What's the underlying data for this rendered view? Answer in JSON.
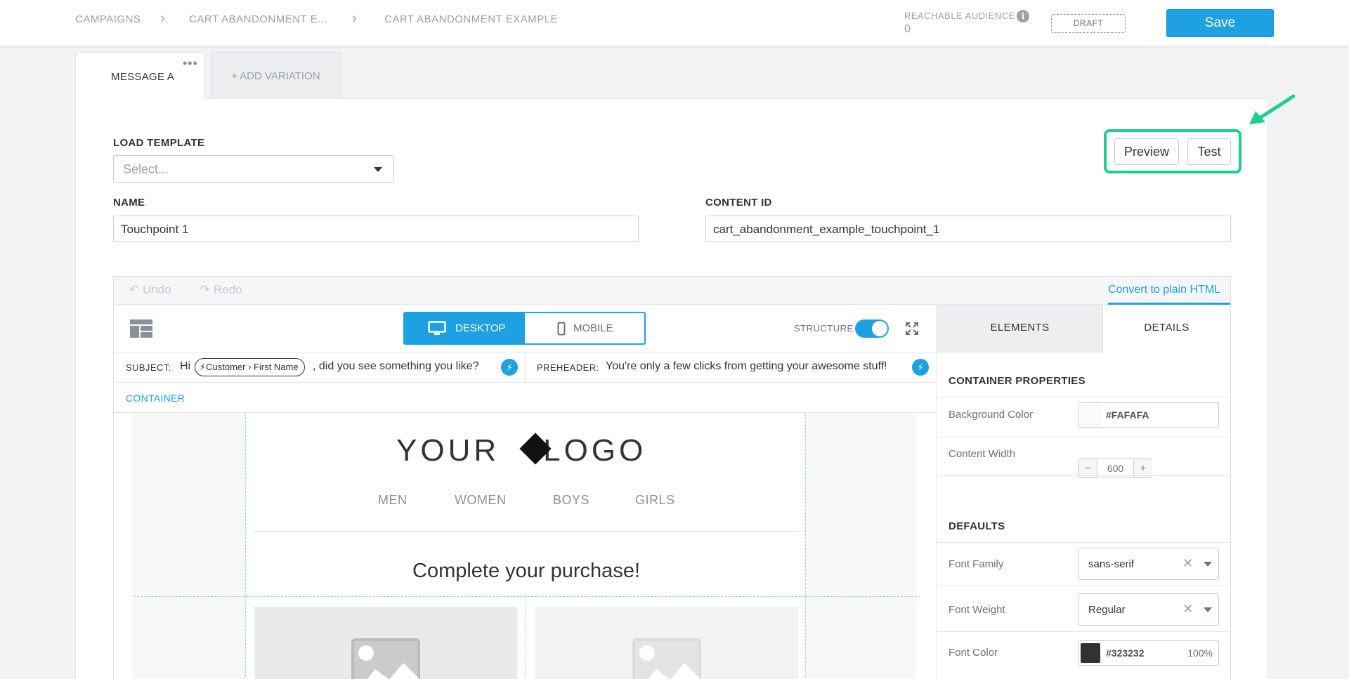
{
  "header": {
    "breadcrumbs": [
      "CAMPAIGNS",
      "CART ABANDONMENT E...",
      "CART ABANDONMENT EXAMPLE"
    ],
    "reachable_audience_label": "REACHABLE AUDIENCE",
    "reachable_audience_value": "0",
    "status_badge": "DRAFT",
    "save_label": "Save"
  },
  "tabs": {
    "message_a": "MESSAGE A",
    "add_variation": "+ ADD VARIATION"
  },
  "form": {
    "load_template_label": "LOAD TEMPLATE",
    "load_template_placeholder": "Select...",
    "name_label": "NAME",
    "name_value": "Touchpoint 1",
    "content_id_label": "CONTENT ID",
    "content_id_value": "cart_abandonment_example_touchpoint_1",
    "preview_label": "Preview",
    "test_label": "Test",
    "highlight_color": "#1fd08c"
  },
  "editor": {
    "undo_label": "Undo",
    "redo_label": "Redo",
    "convert_label": "Convert to plain HTML",
    "desktop_label": "DESKTOP",
    "mobile_label": "MOBILE",
    "structure_label": "STRUCTURE",
    "structure_on": true,
    "subject_label": "SUBJECT:",
    "subject_prefix": "Hi",
    "subject_token": "Customer › First Name",
    "subject_suffix": ", did you see something you like?",
    "preheader_label": "PREHEADER:",
    "preheader_text": "You're only a few clicks from getting your awesome stuff!",
    "container_label": "CONTAINER",
    "accent_color": "#1da1e2"
  },
  "email": {
    "logo_left": "YOUR",
    "logo_right": "LOGO",
    "nav": [
      "MEN",
      "WOMEN",
      "BOYS",
      "GIRLS"
    ],
    "headline": "Complete your purchase!"
  },
  "panel": {
    "tab_elements": "ELEMENTS",
    "tab_details": "DETAILS",
    "container_properties": "CONTAINER PROPERTIES",
    "background_color_label": "Background Color",
    "background_color_value": "#FAFAFA",
    "content_width_label": "Content Width",
    "content_width_value": "600",
    "defaults": "DEFAULTS",
    "font_family_label": "Font Family",
    "font_family_value": "sans-serif",
    "font_weight_label": "Font Weight",
    "font_weight_value": "Regular",
    "font_color_label": "Font Color",
    "font_color_value": "#323232",
    "font_color_opacity": "100%"
  }
}
